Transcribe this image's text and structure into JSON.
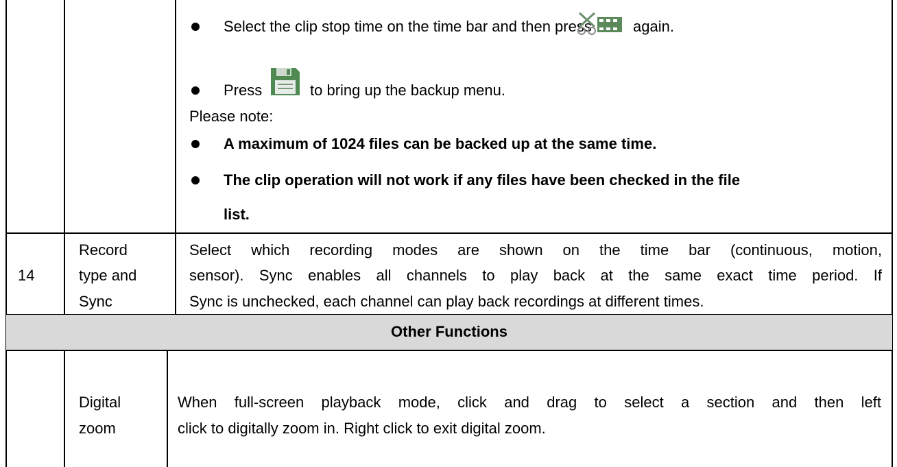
{
  "row_continued": {
    "bullet1_before": "Select the clip stop time on the time bar and then press",
    "bullet1_after": "again.",
    "bullet1_icon": "clip-scissors-icon",
    "bullet2_before": "Press",
    "bullet2_after": "to bring up the backup menu.",
    "bullet2_icon": "floppy-save-icon",
    "note_label": "Please note:",
    "note1": "A maximum of 1024 files can be backed up at the same time.",
    "note2_line1": "The clip operation will not work if any files have been checked in the file",
    "note2_line2": "list."
  },
  "row14": {
    "number": "14",
    "name_line1": "Record",
    "name_line2": "type and",
    "name_line3": "Sync",
    "desc_line1": "Select which recording modes are shown on the time bar (continuous, motion,",
    "desc_line2": "sensor). Sync enables all channels to play back at the same exact time period.  If",
    "desc_line3": "Sync is unchecked, each channel can play back recordings at different times."
  },
  "section_header": "Other Functions",
  "row_zoom": {
    "name_line1": "Digital",
    "name_line2": "zoom",
    "desc_line1": "When full-screen playback mode, click and drag to select a section and then left",
    "desc_line2": "click to digitally zoom in. Right click to exit digital zoom."
  },
  "colors": {
    "border": "#000000",
    "header_bg": "#d9d9d9",
    "icon_green": "#5a8a5a"
  }
}
